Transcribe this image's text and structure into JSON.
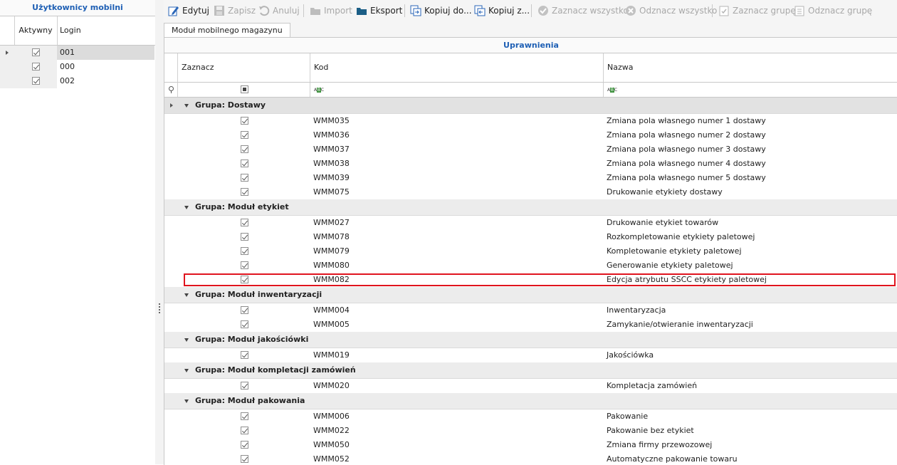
{
  "users_panel": {
    "title": "Użytkownicy mobilni",
    "columns": {
      "active": "Aktywny",
      "login": "Login"
    },
    "users": [
      {
        "login": "001",
        "active": true,
        "selected": true
      },
      {
        "login": "000",
        "active": true,
        "selected": false
      },
      {
        "login": "002",
        "active": true,
        "selected": false
      }
    ]
  },
  "toolbar": {
    "edit": "Edytuj",
    "save": "Zapisz",
    "cancel": "Anuluj",
    "import": "Import",
    "export": "Eksport",
    "copy_to": "Kopiuj do...",
    "copy_from": "Kopiuj z...",
    "select_all": "Zaznacz wszystko",
    "deselect_all": "Odznacz wszystko",
    "select_group": "Zaznacz grupę",
    "deselect_group": "Odznacz grupę"
  },
  "tab": {
    "label": "Moduł mobilnego magazynu"
  },
  "grid": {
    "band_title": "Uprawnienia",
    "columns": {
      "select": "Zaznacz",
      "code": "Kod",
      "name": "Nazwa"
    },
    "groups": [
      {
        "label": "Grupa: Dostawy",
        "rows": [
          {
            "code": "WMM035",
            "name": "Zmiana pola własnego numer 1 dostawy"
          },
          {
            "code": "WMM036",
            "name": "Zmiana pola własnego numer 2 dostawy"
          },
          {
            "code": "WMM037",
            "name": "Zmiana pola własnego numer 3 dostawy"
          },
          {
            "code": "WMM038",
            "name": "Zmiana pola własnego numer 4 dostawy"
          },
          {
            "code": "WMM039",
            "name": "Zmiana pola własnego numer 5 dostawy"
          },
          {
            "code": "WMM075",
            "name": "Drukowanie etykiety dostawy"
          }
        ]
      },
      {
        "label": "Grupa: Moduł etykiet",
        "rows": [
          {
            "code": "WMM027",
            "name": "Drukowanie etykiet towarów"
          },
          {
            "code": "WMM078",
            "name": "Rozkompletowanie etykiety paletowej"
          },
          {
            "code": "WMM079",
            "name": "Kompletowanie etykiety paletowej"
          },
          {
            "code": "WMM080",
            "name": "Generowanie etykiety paletowej"
          },
          {
            "code": "WMM082",
            "name": "Edycja atrybutu SSCC etykiety paletowej",
            "highlighted": true
          }
        ]
      },
      {
        "label": "Grupa: Moduł inwentaryzacji",
        "rows": [
          {
            "code": "WMM004",
            "name": "Inwentaryzacja"
          },
          {
            "code": "WMM005",
            "name": "Zamykanie/otwieranie inwentaryzacji"
          }
        ]
      },
      {
        "label": "Grupa: Moduł jakościówki",
        "rows": [
          {
            "code": "WMM019",
            "name": "Jakościówka"
          }
        ]
      },
      {
        "label": "Grupa: Moduł kompletacji zamówień",
        "rows": [
          {
            "code": "WMM020",
            "name": "Kompletacja zamówień"
          }
        ]
      },
      {
        "label": "Grupa: Moduł pakowania",
        "rows": [
          {
            "code": "WMM006",
            "name": "Pakowanie"
          },
          {
            "code": "WMM022",
            "name": "Pakowanie bez etykiet"
          },
          {
            "code": "WMM050",
            "name": "Zmiana firmy przewozowej"
          },
          {
            "code": "WMM052",
            "name": "Automatyczne pakowanie towaru"
          }
        ]
      }
    ]
  },
  "colors": {
    "accent": "#1e5fb4",
    "highlight_border": "#e0141e"
  }
}
